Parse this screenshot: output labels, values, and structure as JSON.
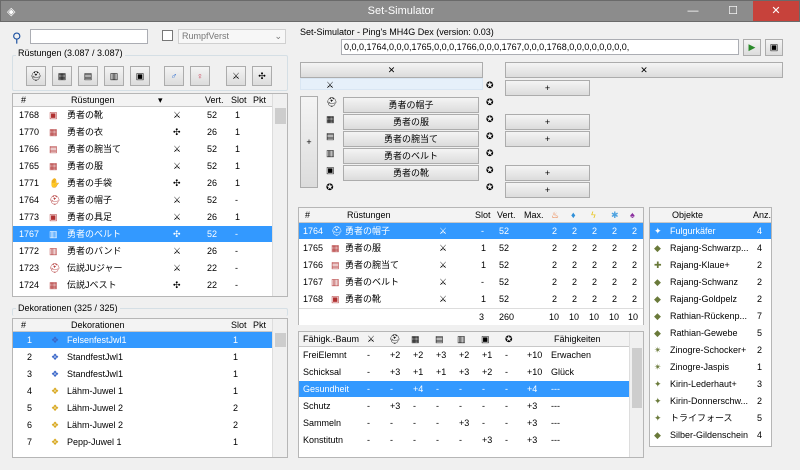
{
  "window": {
    "title": "Set-Simulator",
    "icon": "app-icon",
    "minimize": "—",
    "maximize": "☐",
    "close": "✕"
  },
  "left": {
    "search_value": "",
    "checkbox_label": "RumpfVerst",
    "armor_group_label": "Rüstungen (3.087 / 3.087)",
    "armor_headers": [
      "#",
      "Rüstungen",
      "Vert.",
      "Slot",
      "Pkt"
    ],
    "armor_rows": [
      {
        "id": "1768",
        "name": "勇者の靴",
        "vert": "52",
        "slot": "1",
        "selected": false
      },
      {
        "id": "1770",
        "name": "勇者の衣",
        "vert": "26",
        "slot": "1",
        "selected": false
      },
      {
        "id": "1766",
        "name": "勇者の腕当て",
        "vert": "52",
        "slot": "1",
        "selected": false
      },
      {
        "id": "1765",
        "name": "勇者の服",
        "vert": "52",
        "slot": "1",
        "selected": false
      },
      {
        "id": "1771",
        "name": "勇者の手袋",
        "vert": "26",
        "slot": "1",
        "selected": false
      },
      {
        "id": "1764",
        "name": "勇者の帽子",
        "vert": "52",
        "slot": "-",
        "selected": false
      },
      {
        "id": "1773",
        "name": "勇者の具足",
        "vert": "26",
        "slot": "1",
        "selected": false
      },
      {
        "id": "1767",
        "name": "勇者のベルト",
        "vert": "52",
        "slot": "-",
        "selected": true
      },
      {
        "id": "1772",
        "name": "勇者のバンド",
        "vert": "26",
        "slot": "-",
        "selected": false
      },
      {
        "id": "1723",
        "name": "伝説JUジャー",
        "vert": "22",
        "slot": "-",
        "selected": false
      },
      {
        "id": "1724",
        "name": "伝説Jベスト",
        "vert": "22",
        "slot": "-",
        "selected": false
      }
    ],
    "deco_group_label": "Dekorationen (325 / 325)",
    "deco_headers": [
      "#",
      "Dekorationen",
      "Slot",
      "Pkt"
    ],
    "deco_rows": [
      {
        "id": "1",
        "name": "FelsenfestJwl1",
        "slot": "1",
        "selected": true
      },
      {
        "id": "2",
        "name": "StandfestJwl1",
        "slot": "1",
        "selected": false
      },
      {
        "id": "3",
        "name": "StandfestJwl1",
        "slot": "1",
        "selected": false
      },
      {
        "id": "4",
        "name": "Lähm-Juwel 1",
        "slot": "1",
        "selected": false
      },
      {
        "id": "5",
        "name": "Lähm-Juwel 2",
        "slot": "2",
        "selected": false
      },
      {
        "id": "6",
        "name": "Lähm-Juwel 2",
        "slot": "2",
        "selected": false
      },
      {
        "id": "7",
        "name": "Pepp-Juwel 1",
        "slot": "1",
        "selected": false
      }
    ]
  },
  "right": {
    "sim_label": "Set-Simulator - Ping's MH4G Dex (version: 0.03)",
    "code_value": "0,0,0,1764,0,0,0,1765,0,0,0,1766,0,0,0,1767,0,0,0,1768,0,0,0,0,0,0,0,0,",
    "x_label": "✕",
    "plus_label": "+",
    "weapon_label": "",
    "slot_items": [
      "勇者の帽子",
      "勇者の服",
      "勇者の腕当て",
      "勇者のベルト",
      "勇者の靴",
      ""
    ],
    "set_headers": [
      "#",
      "Rüstungen",
      "Slot",
      "Vert.",
      "Max."
    ],
    "set_rows": [
      {
        "id": "1764",
        "name": "勇者の帽子",
        "slot": "-",
        "vert": "52",
        "max": "",
        "r": [
          "2",
          "2",
          "2",
          "2",
          "2"
        ],
        "selected": true
      },
      {
        "id": "1765",
        "name": "勇者の服",
        "slot": "1",
        "vert": "52",
        "max": "",
        "r": [
          "2",
          "2",
          "2",
          "2",
          "2"
        ],
        "selected": false
      },
      {
        "id": "1766",
        "name": "勇者の腕当て",
        "slot": "1",
        "vert": "52",
        "max": "",
        "r": [
          "2",
          "2",
          "2",
          "2",
          "2"
        ],
        "selected": false
      },
      {
        "id": "1767",
        "name": "勇者のベルト",
        "slot": "-",
        "vert": "52",
        "max": "",
        "r": [
          "2",
          "2",
          "2",
          "2",
          "2"
        ],
        "selected": false
      },
      {
        "id": "1768",
        "name": "勇者の靴",
        "slot": "1",
        "vert": "52",
        "max": "",
        "r": [
          "2",
          "2",
          "2",
          "2",
          "2"
        ],
        "selected": false
      }
    ],
    "set_total": {
      "slot": "3",
      "vert": "260",
      "r": [
        "10",
        "10",
        "10",
        "10",
        "10"
      ]
    },
    "skill_headers": {
      "tree": "Fähigk.-Baum",
      "skills": "Fähigkeiten"
    },
    "skill_rows": [
      {
        "tree": "FreiElemnt",
        "v": [
          "-",
          "+2",
          "+2",
          "+3",
          "+2",
          "+1",
          "-"
        ],
        "sum": "+10",
        "skill": "Erwachen",
        "selected": false
      },
      {
        "tree": "Schicksal",
        "v": [
          "-",
          "+3",
          "+1",
          "+1",
          "+3",
          "+2",
          "-"
        ],
        "sum": "+10",
        "skill": "Glück",
        "selected": false
      },
      {
        "tree": "Gesundheit",
        "v": [
          "-",
          "-",
          "+4",
          "-",
          "-",
          "-",
          "-"
        ],
        "sum": "+4",
        "skill": "---",
        "selected": true
      },
      {
        "tree": "Schutz",
        "v": [
          "-",
          "+3",
          "-",
          "-",
          "-",
          "-",
          "-"
        ],
        "sum": "+3",
        "skill": "---",
        "selected": false
      },
      {
        "tree": "Sammeln",
        "v": [
          "-",
          "-",
          "-",
          "-",
          "+3",
          "-",
          "-"
        ],
        "sum": "+3",
        "skill": "---",
        "selected": false
      },
      {
        "tree": "Konstitutn",
        "v": [
          "-",
          "-",
          "-",
          "-",
          "-",
          "+3",
          "-"
        ],
        "sum": "+3",
        "skill": "---",
        "selected": false
      }
    ],
    "obj_headers": {
      "name": "Objekte",
      "count": "Anz."
    },
    "obj_rows": [
      {
        "name": "Fulgurkäfer",
        "count": "4",
        "selected": true
      },
      {
        "name": "Rajang-Schwarzp...",
        "count": "4",
        "selected": false
      },
      {
        "name": "Rajang-Klaue+",
        "count": "2",
        "selected": false
      },
      {
        "name": "Rajang-Schwanz",
        "count": "2",
        "selected": false
      },
      {
        "name": "Rajang-Goldpelz",
        "count": "2",
        "selected": false
      },
      {
        "name": "Rathian-Rückenp...",
        "count": "7",
        "selected": false
      },
      {
        "name": "Rathian-Gewebe",
        "count": "5",
        "selected": false
      },
      {
        "name": "Zinogre-Schocker+",
        "count": "2",
        "selected": false
      },
      {
        "name": "Zinogre-Jaspis",
        "count": "1",
        "selected": false
      },
      {
        "name": "Kirin-Lederhaut+",
        "count": "3",
        "selected": false
      },
      {
        "name": "Kirin-Donnerschw...",
        "count": "2",
        "selected": false
      },
      {
        "name": "トライフォース",
        "count": "5",
        "selected": false
      },
      {
        "name": "Silber-Gildenschein",
        "count": "4",
        "selected": false
      }
    ]
  },
  "colors": {
    "selection": "#3399ff",
    "close": "#c7423b",
    "titlebar": "#8c8c8c",
    "fire": "#e8631c",
    "water": "#2f8fd8",
    "thunder": "#e8c51c",
    "ice": "#4fa3e0",
    "dragon": "#8a2e9e"
  }
}
